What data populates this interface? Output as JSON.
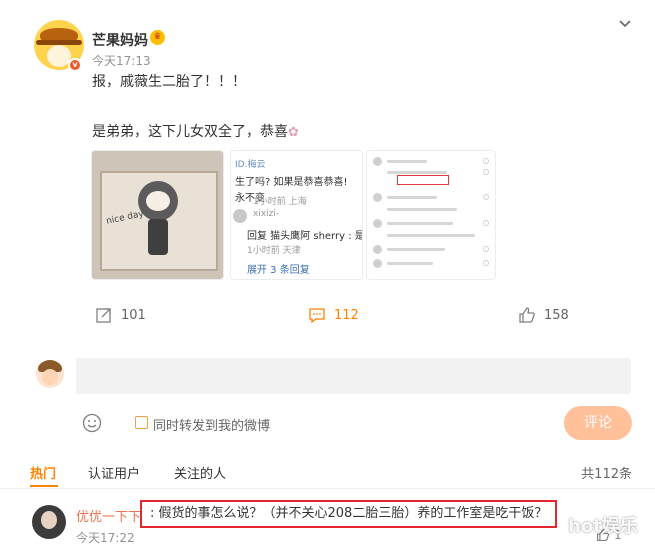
{
  "post": {
    "author": "芒果妈妈",
    "time": "今天17:13",
    "line1": "报，戚薇生二胎了！！！",
    "line2": "是弟弟，这下儿女双全了，恭喜",
    "images": {
      "img1_note": "nice day",
      "img2_lines": {
        "l1": "ID.梅云",
        "l2": "生了吗? 如果是恭喜恭喜!",
        "l3": "永不变",
        "meta1": "1小时前 上海",
        "user2": "xixizi-",
        "l4": "回复 猫头鹰阿 sherry : 是弟",
        "meta2": "1小时前 天津",
        "expand": "展开 3 条回复"
      }
    }
  },
  "actions": {
    "repost_count": "101",
    "comment_count": "112",
    "like_count": "158"
  },
  "composer": {
    "repost_label": "同时转发到我的微博",
    "submit_label": "评论"
  },
  "tabs": {
    "hot": "热门",
    "verified": "认证用户",
    "following": "关注的人",
    "total": "共112条"
  },
  "comment": {
    "user": "优优一下下",
    "text": ": 假货的事怎么说？（并不关心208二胎三胎）养的工作室是吃干饭？",
    "time": "今天17:22",
    "like": "1"
  },
  "watermark": "hot娱乐",
  "colors": {
    "accent": "#ff8200",
    "link": "#eb7350",
    "highlight_border": "#e0282e"
  }
}
